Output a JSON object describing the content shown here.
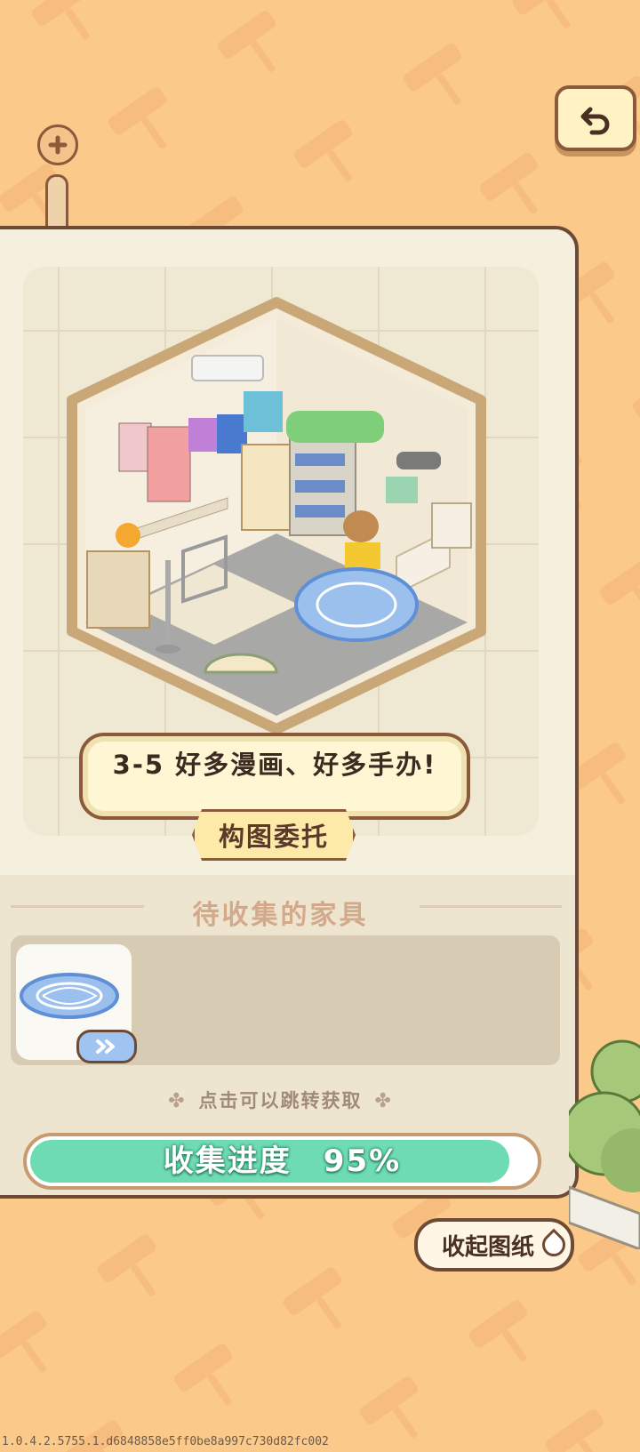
{
  "header": {
    "back_icon": "undo-arrow-icon",
    "zoom_icon": "plus-icon"
  },
  "blueprint": {
    "level_title": "3-5 好多漫画、好多手办!",
    "commission_label": "构图委托"
  },
  "furniture": {
    "section_title": "待收集的家具",
    "items": [
      {
        "icon": "blue-round-rug-icon",
        "jump_icon": "double-chevron-right-icon"
      }
    ],
    "hint": "点击可以跳转获取",
    "hint_icon": "clover-icon"
  },
  "progress": {
    "label": "收集进度",
    "value_text": "95%",
    "value": 0.95
  },
  "collapse_button": {
    "label": "收起图纸"
  },
  "footer": {
    "version": "1.0.4.2.5755.1.d6848858e5ff0be8a997c730d82fc002"
  },
  "colors": {
    "background": "#fbc98a",
    "progress_fill": "#6fdbb2",
    "panel": "#f5f0dd",
    "border": "#6e4a34"
  }
}
